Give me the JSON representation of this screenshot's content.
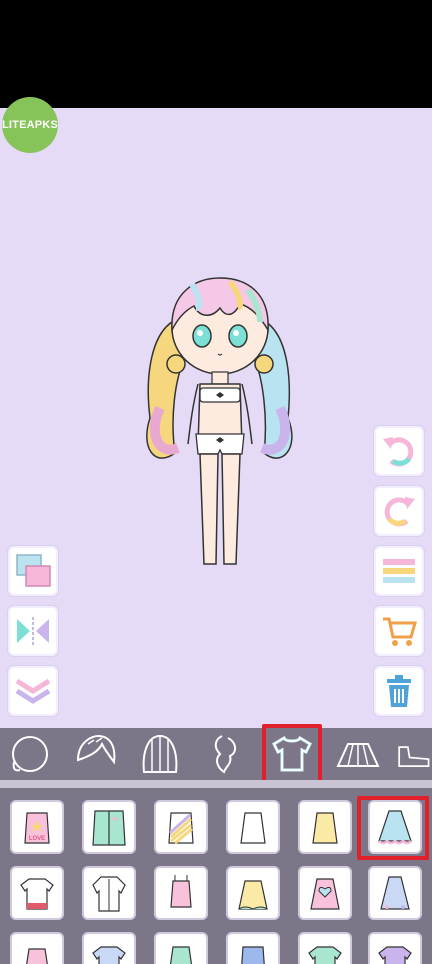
{
  "watermark": {
    "label": "LITEAPKS"
  },
  "colors": {
    "background": "#e6dbf7",
    "toolbar": "#7d7688",
    "highlight": "#e0202a",
    "watermark": "#86c45a"
  },
  "left_tools": [
    {
      "name": "layer-swap-icon"
    },
    {
      "name": "flip-horizontal-icon"
    },
    {
      "name": "collapse-chevron-icon"
    }
  ],
  "right_tools": [
    {
      "name": "undo-icon"
    },
    {
      "name": "redo-icon"
    },
    {
      "name": "menu-lines-icon"
    },
    {
      "name": "shopping-cart-icon"
    },
    {
      "name": "trash-icon"
    }
  ],
  "category_tabs": [
    {
      "name": "face-icon",
      "selected": false
    },
    {
      "name": "front-hair-icon",
      "selected": false
    },
    {
      "name": "back-hair-icon",
      "selected": false
    },
    {
      "name": "side-hair-icon",
      "selected": false
    },
    {
      "name": "top-shirt-icon",
      "selected": true
    },
    {
      "name": "skirt-icon",
      "selected": false
    },
    {
      "name": "shoes-icon",
      "selected": false
    }
  ],
  "clothing_items": [
    {
      "name": "pink-love-tank",
      "text": "LOVE",
      "selected": false
    },
    {
      "name": "mint-cardigan",
      "selected": false
    },
    {
      "name": "rainbow-stripe-tank",
      "selected": false
    },
    {
      "name": "white-tank",
      "selected": false
    },
    {
      "name": "yellow-tank",
      "selected": false
    },
    {
      "name": "blue-ruffle-dress",
      "selected": true
    },
    {
      "name": "white-red-tee",
      "selected": false
    },
    {
      "name": "white-shirt",
      "selected": false
    },
    {
      "name": "pink-camisole",
      "selected": false
    },
    {
      "name": "yellow-camisole",
      "selected": false
    },
    {
      "name": "pink-heart-dress",
      "selected": false
    },
    {
      "name": "blue-bow-dress",
      "selected": false
    },
    {
      "name": "pink-strap-top",
      "selected": false
    },
    {
      "name": "blue-collar-top",
      "selected": false
    },
    {
      "name": "mint-cross-top",
      "selected": false
    },
    {
      "name": "blue-square-neck",
      "selected": false
    },
    {
      "name": "mint-tee",
      "selected": false
    },
    {
      "name": "purple-tee",
      "selected": false
    }
  ]
}
